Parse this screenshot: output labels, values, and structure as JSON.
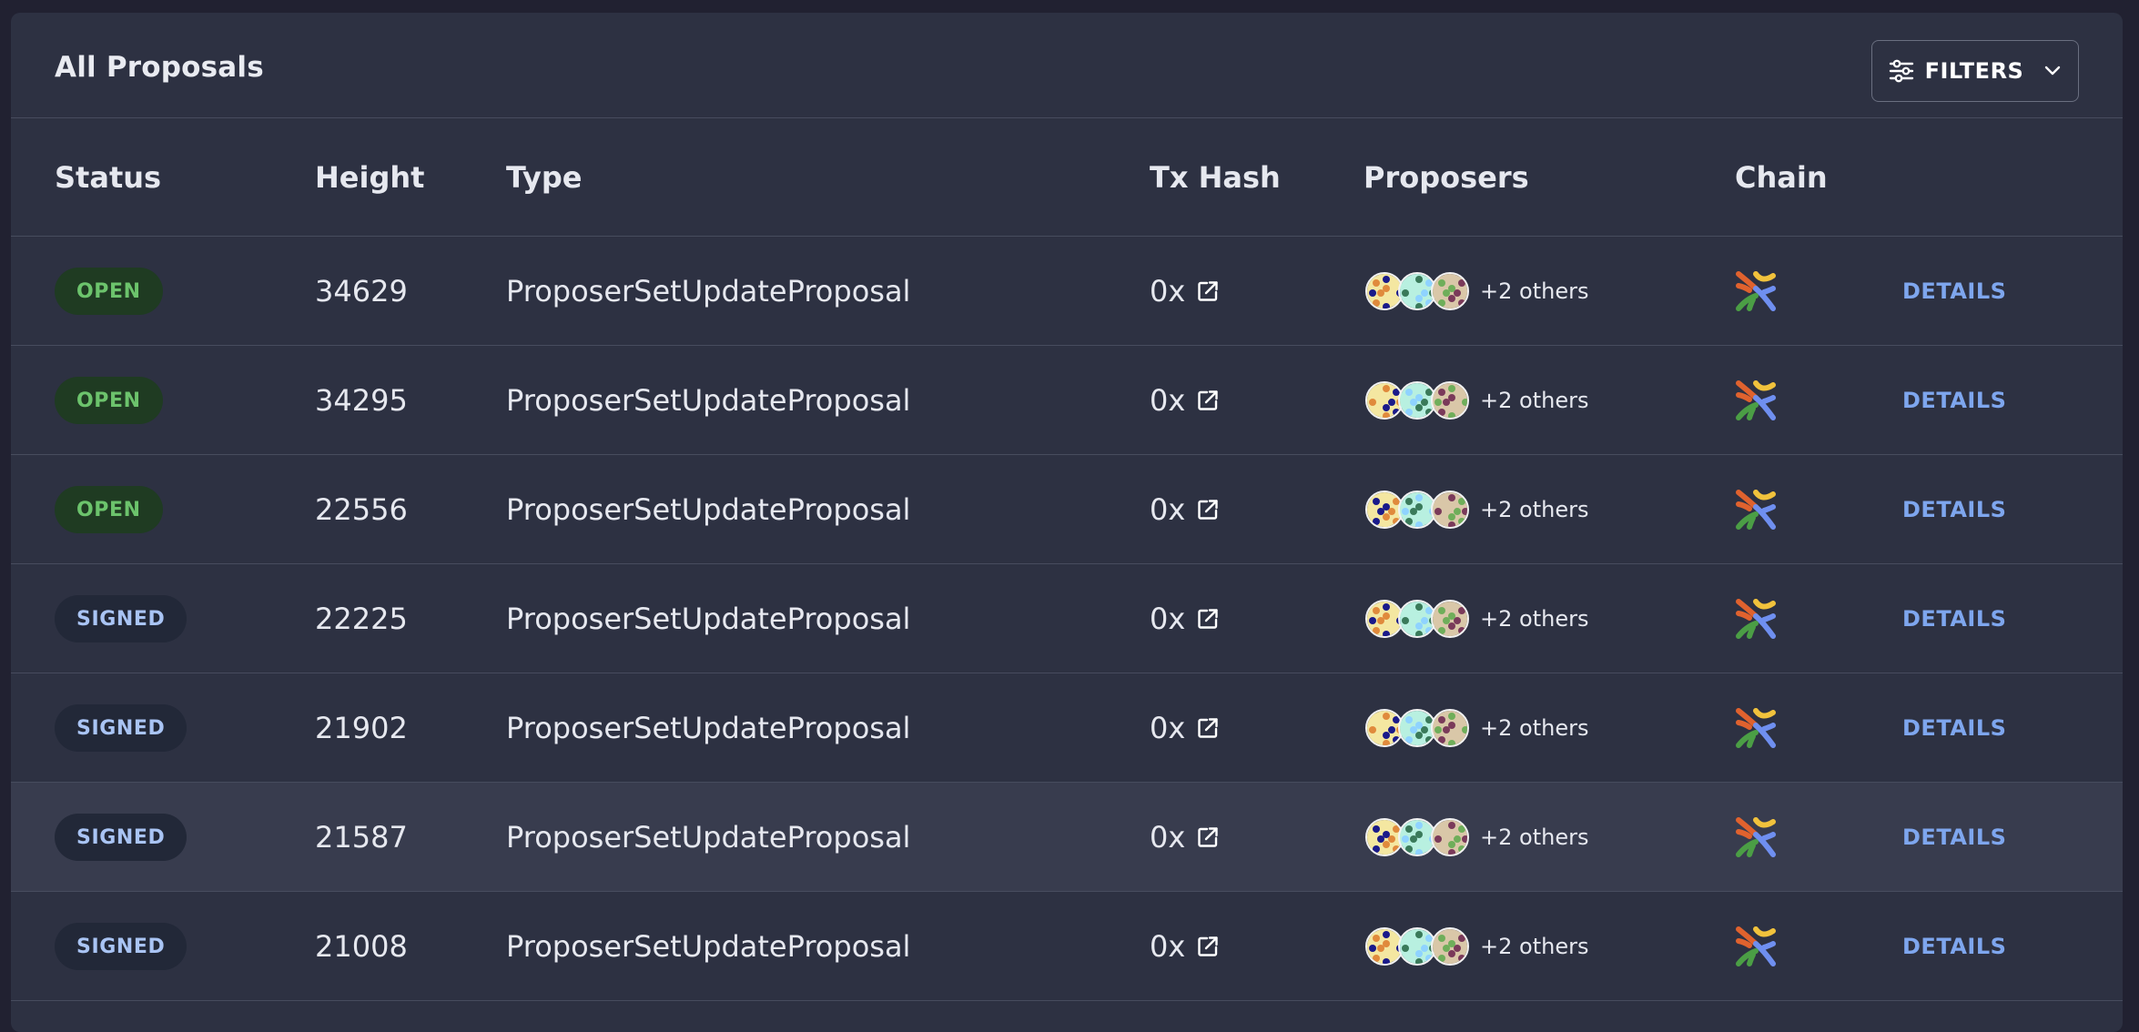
{
  "page": {
    "title": "All Proposals",
    "filters_label": "FILTERS"
  },
  "table": {
    "headers": [
      "Status",
      "Height",
      "Type",
      "Tx Hash",
      "Proposers",
      "Chain"
    ],
    "details_label": "DETAILS",
    "rows": [
      {
        "status": "OPEN",
        "status_kind": "open",
        "height": "34629",
        "type": "ProposerSetUpdateProposal",
        "tx_hash": "0x",
        "others": "+2 others"
      },
      {
        "status": "OPEN",
        "status_kind": "open",
        "height": "34295",
        "type": "ProposerSetUpdateProposal",
        "tx_hash": "0x",
        "others": "+2 others"
      },
      {
        "status": "OPEN",
        "status_kind": "open",
        "height": "22556",
        "type": "ProposerSetUpdateProposal",
        "tx_hash": "0x",
        "others": "+2 others"
      },
      {
        "status": "SIGNED",
        "status_kind": "signed",
        "height": "22225",
        "type": "ProposerSetUpdateProposal",
        "tx_hash": "0x",
        "others": "+2 others"
      },
      {
        "status": "SIGNED",
        "status_kind": "signed",
        "height": "21902",
        "type": "ProposerSetUpdateProposal",
        "tx_hash": "0x",
        "others": "+2 others"
      },
      {
        "status": "SIGNED",
        "status_kind": "signed",
        "height": "21587",
        "type": "ProposerSetUpdateProposal",
        "tx_hash": "0x",
        "others": "+2 others"
      },
      {
        "status": "SIGNED",
        "status_kind": "signed",
        "height": "21008",
        "type": "ProposerSetUpdateProposal",
        "tx_hash": "0x",
        "others": "+2 others"
      }
    ]
  },
  "icons": {
    "filters": "sliders-icon",
    "dropdown": "chevron-down-icon",
    "tx_link": "external-link-icon",
    "chain": "chain-logo-icon",
    "avatar": "identicon-avatar"
  },
  "colors": {
    "background": "#212131",
    "card": "#2d3142",
    "open_badge_bg": "#1f3b22",
    "open_badge_text": "#6cc36c",
    "signed_badge_bg": "#222838",
    "signed_badge_text": "#a9c4f4",
    "details_link": "#7ea6ee",
    "hover_row": "#383c4e"
  }
}
